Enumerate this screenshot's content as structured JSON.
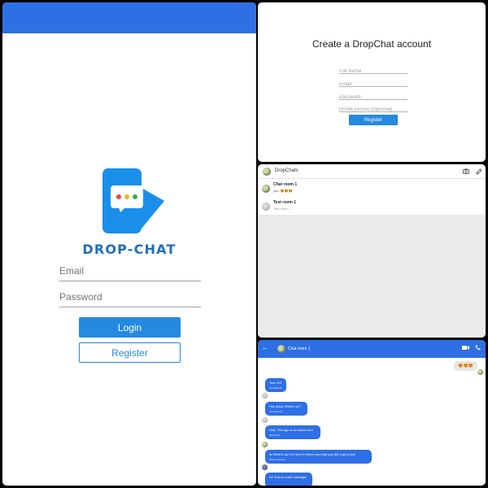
{
  "login": {
    "brand": "DROP-CHAT",
    "email_placeholder": "Email",
    "password_placeholder": "Password",
    "login_label": "Login",
    "register_label": "Register",
    "topbar_color": "#2f6fe4"
  },
  "register": {
    "title": "Create a DropChat account",
    "fields": [
      {
        "placeholder": "Full Name"
      },
      {
        "placeholder": "Email"
      },
      {
        "placeholder": "Password"
      },
      {
        "placeholder": "Profile Picture (Optional)"
      }
    ],
    "button_label": "Register"
  },
  "chatlist": {
    "app_title": "DropChats",
    "icons": [
      "camera-icon",
      "pencil-icon"
    ],
    "items": [
      {
        "name": "Chat room 1",
        "sender": "you:",
        "preview": "😍😍😍"
      },
      {
        "name": "Test room 1",
        "sender": "",
        "preview": "Test Video",
        "time": "..."
      }
    ]
  },
  "chatroom": {
    "room_name": "Chat room 1",
    "my_message": "😍😍😍",
    "messages": [
      {
        "text": "Test 123",
        "name": "Joe Moleoft"
      },
      {
        "text": "Hey guys! What's up?",
        "name": "Joe Moleoft"
      },
      {
        "text": "Hey! This app is so damn cool",
        "name": "Bart Reid"
      },
      {
        "text": "lol What's up! I'm here to inform you that you did a good job!",
        "name": "Marco Gorbing"
      },
      {
        "text": "Hi! This is a test message",
        "name": ""
      }
    ],
    "header_color": "#2f6fe4",
    "bubble_color": "#2e6fe6"
  }
}
